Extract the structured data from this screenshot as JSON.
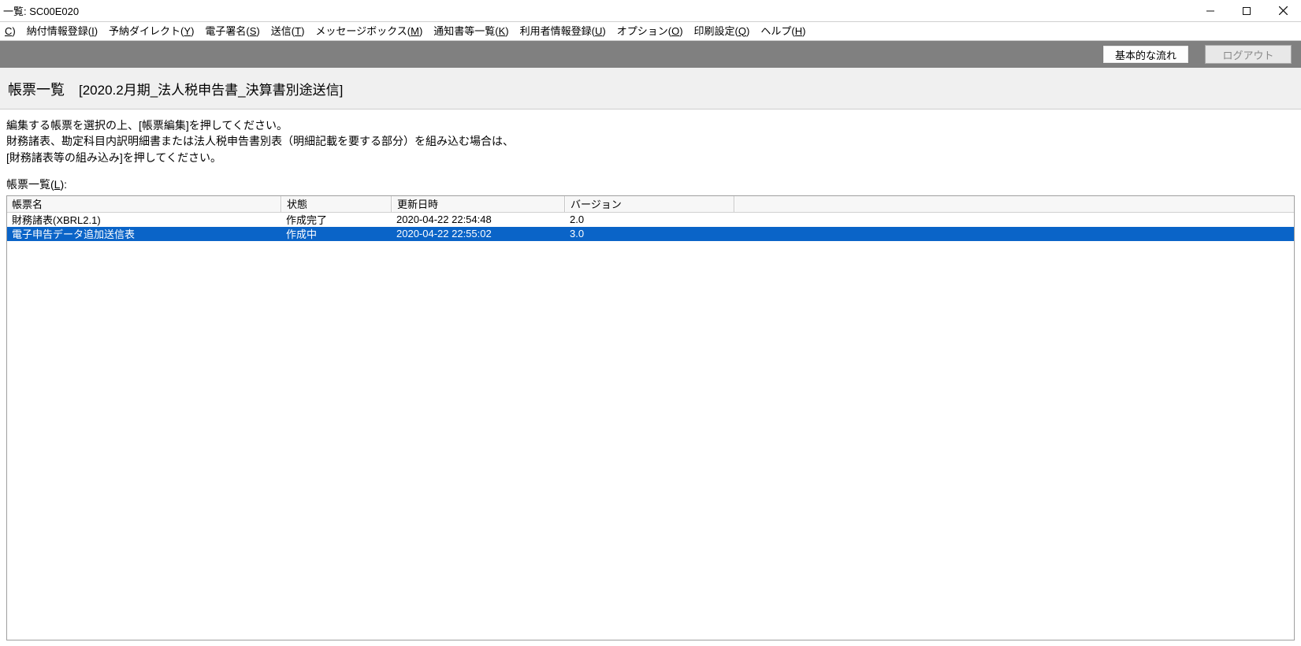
{
  "window": {
    "title": "一覧: SC00E020"
  },
  "menu": {
    "items": [
      {
        "label_pre": "",
        "hotkey": "C",
        "label_post": ")"
      },
      {
        "label_pre": "納付情報登録(",
        "hotkey": "I",
        "label_post": ")"
      },
      {
        "label_pre": "予納ダイレクト(",
        "hotkey": "Y",
        "label_post": ")"
      },
      {
        "label_pre": "電子署名(",
        "hotkey": "S",
        "label_post": ")"
      },
      {
        "label_pre": "送信(",
        "hotkey": "T",
        "label_post": ")"
      },
      {
        "label_pre": "メッセージボックス(",
        "hotkey": "M",
        "label_post": ")"
      },
      {
        "label_pre": "通知書等一覧(",
        "hotkey": "K",
        "label_post": ")"
      },
      {
        "label_pre": "利用者情報登録(",
        "hotkey": "U",
        "label_post": ")"
      },
      {
        "label_pre": "オプション(",
        "hotkey": "O",
        "label_post": ")"
      },
      {
        "label_pre": "印刷設定(",
        "hotkey": "Q",
        "label_post": ")"
      },
      {
        "label_pre": "ヘルプ(",
        "hotkey": "H",
        "label_post": ")"
      }
    ]
  },
  "toolbar": {
    "flow": "基本的な流れ",
    "logout": "ログアウト"
  },
  "header": {
    "title": "帳票一覧",
    "subtitle": "[2020.2月期_法人税申告書_決算書別途送信]"
  },
  "instructions": {
    "line1": "編集する帳票を選択の上、[帳票編集]を押してください。",
    "line2": "財務諸表、勘定科目内訳明細書または法人税申告書別表（明細記載を要する部分）を組み込む場合は、",
    "line3": "[財務諸表等の組み込み]を押してください。"
  },
  "list": {
    "label_pre": "帳票一覧(",
    "label_hotkey": "L",
    "label_post": "):",
    "columns": {
      "name": "帳票名",
      "status": "状態",
      "date": "更新日時",
      "version": "バージョン"
    },
    "rows": [
      {
        "name": "財務諸表(XBRL2.1)",
        "status": "作成完了",
        "date": "2020-04-22 22:54:48",
        "version": "2.0",
        "selected": false
      },
      {
        "name": "電子申告データ追加送信表",
        "status": "作成中",
        "date": "2020-04-22 22:55:02",
        "version": "3.0",
        "selected": true
      }
    ]
  }
}
